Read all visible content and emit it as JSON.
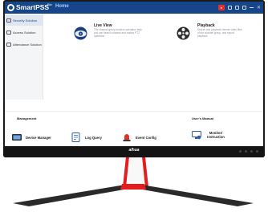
{
  "app": {
    "title": "SmartPSS",
    "title_suffix": "Bio",
    "home_tab": "Home",
    "alert_badge": "●",
    "brand_logo": "alhua"
  },
  "sidebar": {
    "items": [
      {
        "label": "Security Solution",
        "icon": "shield-icon"
      },
      {
        "label": "Access Solution",
        "icon": "door-icon"
      },
      {
        "label": "Attendance Solution",
        "icon": "calendar-icon"
      }
    ]
  },
  "tiles": {
    "live_view": {
      "title": "Live View",
      "desc": "The channel group function operation help you can search channel and realize PTZ operation",
      "icon": "camera-icon"
    },
    "playback": {
      "title": "Playback",
      "desc": "Search and playback remote video files of the channel group, and export playback",
      "icon": "playback-reel-icon"
    }
  },
  "bottom": {
    "management_label": "Management",
    "users_manual_label": "User's Manual",
    "tools": [
      {
        "label": "Device Manager",
        "icon": "device-manager-icon"
      },
      {
        "label": "Log Query",
        "icon": "log-query-icon"
      },
      {
        "label": "Event Config",
        "icon": "event-config-icon"
      },
      {
        "label": "Monitor/ Instruction",
        "icon": "monitor-instruction-icon"
      }
    ]
  },
  "colors": {
    "titlebar": "#16458a",
    "stand": "#e31d1d",
    "alert": "#e0312b"
  }
}
